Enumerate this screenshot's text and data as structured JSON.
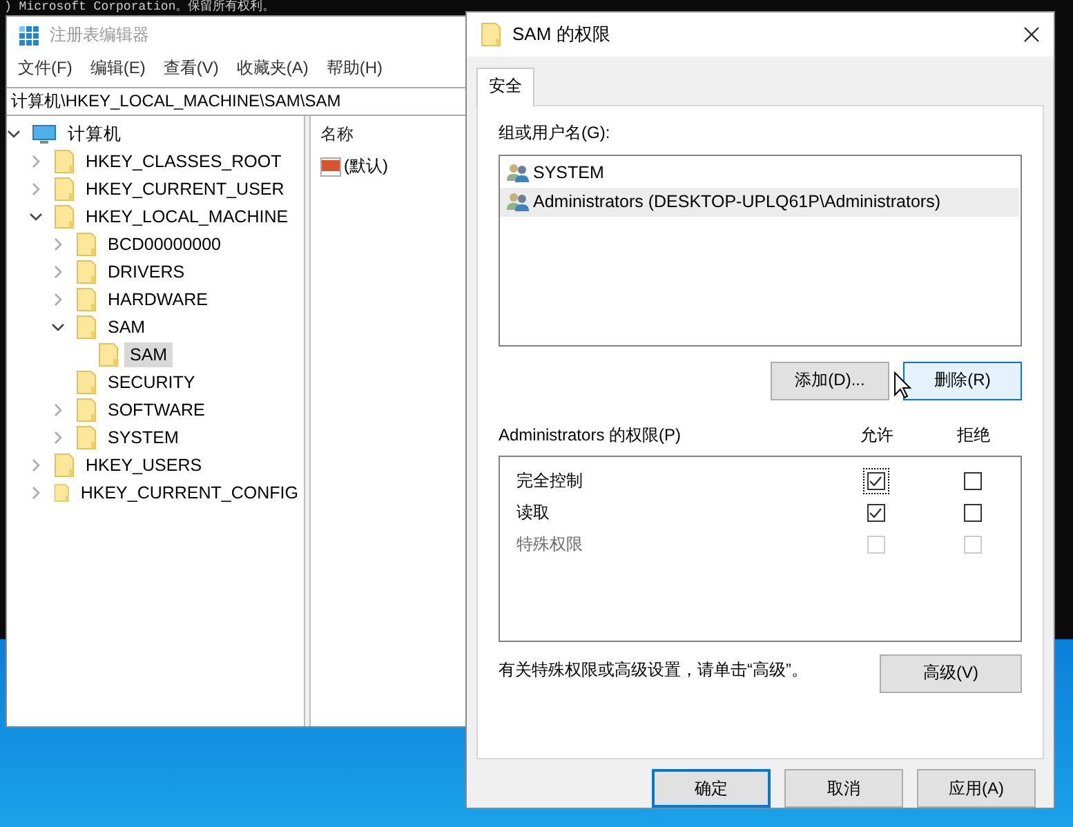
{
  "console": {
    "text": ") Microsoft Corporation。保留所有权利。"
  },
  "regedit": {
    "title": "注册表编辑器",
    "menu": [
      "文件(F)",
      "编辑(E)",
      "查看(V)",
      "收藏夹(A)",
      "帮助(H)"
    ],
    "address": "计算机\\HKEY_LOCAL_MACHINE\\SAM\\SAM",
    "tree": {
      "label": "计算机",
      "kind": "computer",
      "expanded": true,
      "selected": false,
      "children": [
        {
          "label": "HKEY_CLASSES_ROOT",
          "kind": "folder",
          "expanded": false,
          "selected": false
        },
        {
          "label": "HKEY_CURRENT_USER",
          "kind": "folder",
          "expanded": false,
          "selected": false
        },
        {
          "label": "HKEY_LOCAL_MACHINE",
          "kind": "folder",
          "expanded": true,
          "selected": false,
          "children": [
            {
              "label": "BCD00000000",
              "kind": "folder",
              "expanded": false,
              "selected": false
            },
            {
              "label": "DRIVERS",
              "kind": "folder",
              "expanded": false,
              "selected": false
            },
            {
              "label": "HARDWARE",
              "kind": "folder",
              "expanded": false,
              "selected": false
            },
            {
              "label": "SAM",
              "kind": "folder",
              "expanded": true,
              "selected": false,
              "children": [
                {
                  "label": "SAM",
                  "kind": "folder",
                  "selected": true
                }
              ]
            },
            {
              "label": "SECURITY",
              "kind": "folder",
              "selected": false
            },
            {
              "label": "SOFTWARE",
              "kind": "folder",
              "expanded": false,
              "selected": false
            },
            {
              "label": "SYSTEM",
              "kind": "folder",
              "expanded": false,
              "selected": false
            }
          ]
        },
        {
          "label": "HKEY_USERS",
          "kind": "folder",
          "expanded": false,
          "selected": false
        },
        {
          "label": "HKEY_CURRENT_CONFIG",
          "kind": "folder",
          "expanded": false,
          "selected": false
        }
      ]
    },
    "list": {
      "column": "名称",
      "rows": [
        {
          "name": "(默认)"
        }
      ]
    }
  },
  "dialog": {
    "title": "SAM 的权限",
    "tabs": [
      {
        "label": "安全",
        "selected": true
      }
    ],
    "groups_label": "组或用户名(G):",
    "principals": [
      {
        "name": "SYSTEM",
        "selected": false
      },
      {
        "name": "Administrators (DESKTOP-UPLQ61P\\Administrators)",
        "selected": true
      }
    ],
    "principal_buttons": [
      {
        "label": "添加(D)...",
        "hovered": false
      },
      {
        "label": "删除(R)",
        "hovered": true
      }
    ],
    "permissions_label": "Administrators 的权限(P)",
    "columns": [
      "允许",
      "拒绝"
    ],
    "permissions": [
      {
        "name": "完全控制",
        "allow": {
          "checked": true,
          "disabled": false,
          "focused": true
        },
        "deny": {
          "checked": false,
          "disabled": false
        }
      },
      {
        "name": "读取",
        "allow": {
          "checked": true,
          "disabled": false
        },
        "deny": {
          "checked": false,
          "disabled": false
        }
      },
      {
        "name": "特殊权限",
        "allow": {
          "checked": false,
          "disabled": true
        },
        "deny": {
          "checked": false,
          "disabled": true
        }
      }
    ],
    "note": "有关特殊权限或高级设置，请单击“高级”。",
    "advanced": "高级(V)",
    "footer_buttons": [
      {
        "label": "确定",
        "default": true
      },
      {
        "label": "取消",
        "default": false
      },
      {
        "label": "应用(A)",
        "default": false
      }
    ]
  }
}
